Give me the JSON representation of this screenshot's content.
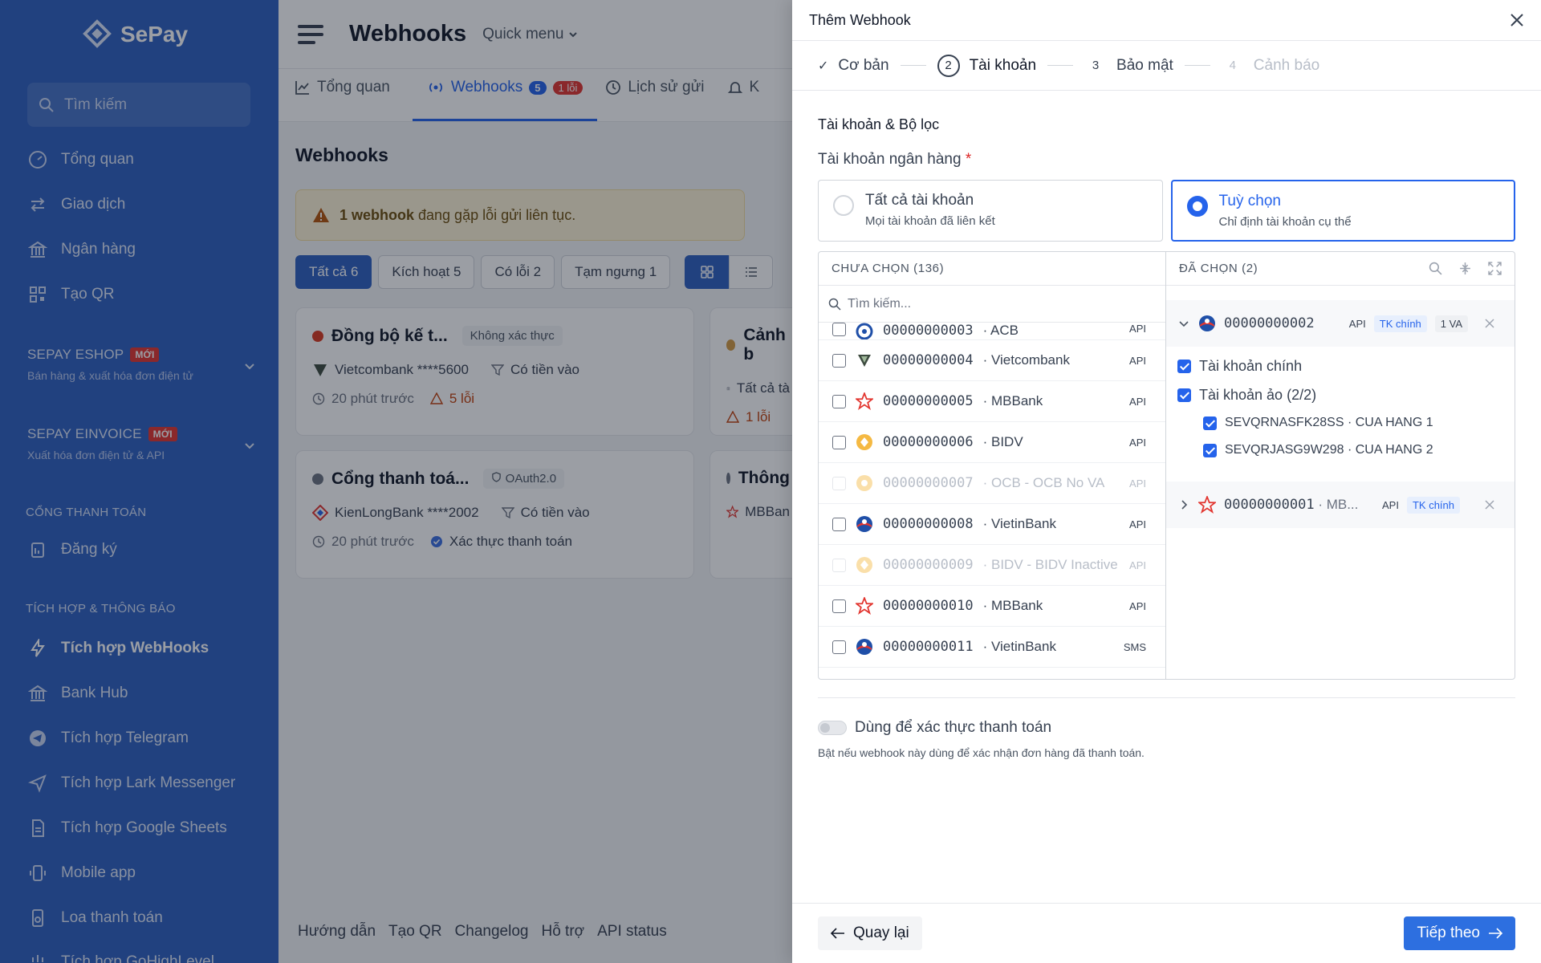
{
  "app": {
    "brand": "SePay"
  },
  "sidebar": {
    "search_placeholder": "Tìm kiếm",
    "main_items": [
      {
        "label": "Tổng quan",
        "icon": "dashboard-icon"
      },
      {
        "label": "Giao dịch",
        "icon": "transfer-icon"
      },
      {
        "label": "Ngân hàng",
        "icon": "bank-icon"
      },
      {
        "label": "Tạo QR",
        "icon": "qr-icon"
      }
    ],
    "groups": [
      {
        "title": "SEPAY ESHOP",
        "badge": "MỚI",
        "subtitle": "Bán hàng & xuất hóa đơn điện tử"
      },
      {
        "title": "SEPAY EINVOICE",
        "badge": "MỚI",
        "subtitle": "Xuất hóa đơn điện tử & API"
      }
    ],
    "section_payment": "CỔNG THANH TOÁN",
    "payment_items": [
      {
        "label": "Đăng ký",
        "icon": "clipboard-icon"
      }
    ],
    "section_integration": "TÍCH HỢP & THÔNG BÁO",
    "integration_items": [
      {
        "label": "Tích hợp WebHooks",
        "icon": "lightning-icon"
      },
      {
        "label": "Bank Hub",
        "icon": "bank-icon"
      },
      {
        "label": "Tích hợp Telegram",
        "icon": "telegram-icon"
      },
      {
        "label": "Tích hợp Lark Messenger",
        "icon": "send-icon"
      },
      {
        "label": "Tích hợp Google Sheets",
        "icon": "sheet-icon"
      },
      {
        "label": "Mobile app",
        "icon": "mobile-icon"
      },
      {
        "label": "Loa thanh toán",
        "icon": "speaker-icon"
      },
      {
        "label": "Tích hợp GoHighLevel",
        "icon": "plug-icon"
      }
    ]
  },
  "topbar": {
    "title": "Webhooks",
    "quick_menu": "Quick menu"
  },
  "tabs": [
    {
      "label": "Tổng quan"
    },
    {
      "label": "Webhooks",
      "count": "5",
      "errors": "1 lỗi"
    },
    {
      "label": "Lịch sử gửi"
    },
    {
      "label": "K"
    }
  ],
  "page": {
    "heading": "Webhooks",
    "alert_bold": "1 webhook",
    "alert_rest": " đang gặp lỗi gửi liên tục.",
    "filters": [
      "Tất cả 6",
      "Kích hoạt 5",
      "Có lỗi 2",
      "Tạm ngưng 1"
    ],
    "cards": [
      {
        "title": "Đồng bộ kế t...",
        "tag": "Không xác thực",
        "bank": "Vietcombank ****5600",
        "filter": "Có tiền vào",
        "time": "20 phút trước",
        "errors": "5 lỗi",
        "dot": "#d9381e"
      },
      {
        "title": "Cảnh b",
        "bank": "Tất cả tà",
        "errors": "1 lỗi",
        "dot": "#d39a43"
      },
      {
        "title": "Cổng thanh toá...",
        "tag": "OAuth2.0",
        "bank": "KienLongBank ****2002",
        "filter": "Có tiền vào",
        "time": "20 phút trước",
        "verify": "Xác thực thanh toán",
        "dot": "#6b7280"
      },
      {
        "title": "Thông",
        "bank": "MBBan",
        "dot": "#6b7280"
      }
    ],
    "footer_links": [
      "Hướng dẫn",
      "Tạo QR",
      "Changelog",
      "Hỗ trợ",
      "API status"
    ]
  },
  "drawer": {
    "title": "Thêm Webhook",
    "steps": [
      {
        "num": "✓",
        "label": "Cơ bản",
        "state": "done"
      },
      {
        "num": "2",
        "label": "Tài khoản",
        "state": "active"
      },
      {
        "num": "3",
        "label": "Bảo mật",
        "state": "upcoming"
      },
      {
        "num": "4",
        "label": "Cảnh báo",
        "state": "disabled"
      }
    ],
    "section_title": "Tài khoản & Bộ lọc",
    "bank_label": "Tài khoản ngân hàng",
    "required_mark": "*",
    "radio_all": {
      "title": "Tất cả tài khoản",
      "subtitle": "Mọi tài khoản đã liên kết"
    },
    "radio_custom": {
      "title": "Tuỳ chọn",
      "subtitle": "Chỉ định tài khoản cụ thể"
    },
    "left_header": "CHƯA CHỌN (136)",
    "left_search_placeholder": "Tìm kiếm...",
    "accounts": [
      {
        "num": "00000000003",
        "bank": "ACB",
        "type": "API",
        "icon": "acb-icon",
        "disabled": false
      },
      {
        "num": "00000000004",
        "bank": "Vietcombank",
        "type": "API",
        "icon": "vietcombank-icon",
        "disabled": false
      },
      {
        "num": "00000000005",
        "bank": "MBBank",
        "type": "API",
        "icon": "mbbank-icon",
        "disabled": false
      },
      {
        "num": "00000000006",
        "bank": "BIDV",
        "type": "API",
        "icon": "bidv-icon",
        "disabled": false
      },
      {
        "num": "00000000007",
        "bank": "OCB - OCB No VA",
        "type": "API",
        "icon": "ocb-icon",
        "disabled": true
      },
      {
        "num": "00000000008",
        "bank": "VietinBank",
        "type": "API",
        "icon": "vietinbank-icon",
        "disabled": false
      },
      {
        "num": "00000000009",
        "bank": "BIDV - BIDV Inactive",
        "type": "API",
        "icon": "bidv-icon",
        "disabled": true
      },
      {
        "num": "00000000010",
        "bank": "MBBank",
        "type": "API",
        "icon": "mbbank-icon",
        "disabled": false
      },
      {
        "num": "00000000011",
        "bank": "VietinBank",
        "type": "SMS",
        "icon": "vietinbank-icon",
        "disabled": false
      }
    ],
    "right_header": "ĐÃ CHỌN (2)",
    "selected": [
      {
        "num": "00000000002",
        "type": "API",
        "chip": "TK chính",
        "va": "1 VA",
        "expanded": true,
        "main_label": "Tài khoản chính",
        "virtual_label": "Tài khoản ảo (2/2)",
        "virtual": [
          "SEVQRNASFK28SS · CUA HANG 1",
          "SEVQRJASG9W298 · CUA HANG 2"
        ]
      },
      {
        "num": "00000000001",
        "suffix": " · MB...",
        "type": "API",
        "chip": "TK chính",
        "expanded": false
      }
    ],
    "toggle_label": "Dùng để xác thực thanh toán",
    "toggle_help": "Bật nếu webhook này dùng để xác nhận đơn hàng đã thanh toán.",
    "back_label": "Quay lại",
    "next_label": "Tiếp theo"
  },
  "colors": {
    "sidebar": "#2d5fc0",
    "accent": "#2563eb",
    "error": "#e2352f"
  }
}
